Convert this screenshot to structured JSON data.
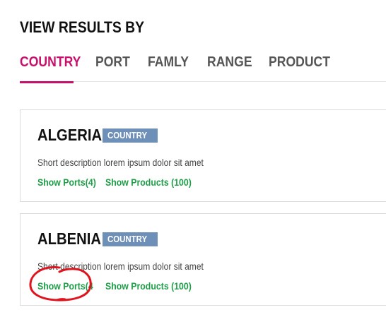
{
  "heading": "VIEW RESULTS BY",
  "tabs": [
    {
      "label": "COUNTRY",
      "active": true
    },
    {
      "label": "PORT",
      "active": false
    },
    {
      "label": "FAMLY",
      "active": false
    },
    {
      "label": "RANGE",
      "active": false
    },
    {
      "label": "PRODUCT",
      "active": false
    }
  ],
  "results": [
    {
      "name": "ALGERIA",
      "badge": "COUNTRY",
      "description": "Short description lorem ipsum dolor sit amet",
      "ports_link": "Show Ports(4)",
      "products_link": "Show Products (100)"
    },
    {
      "name": "ALBENIA",
      "badge": "COUNTRY",
      "description": "Short description lorem ipsum dolor sit amet",
      "ports_link": "Show Ports(4",
      "products_link": "Show Products (100)"
    }
  ],
  "colors": {
    "accent": "#c8106a",
    "badge": "#6e8fb8",
    "link": "#1e9e48",
    "annotation": "#e0141e"
  }
}
